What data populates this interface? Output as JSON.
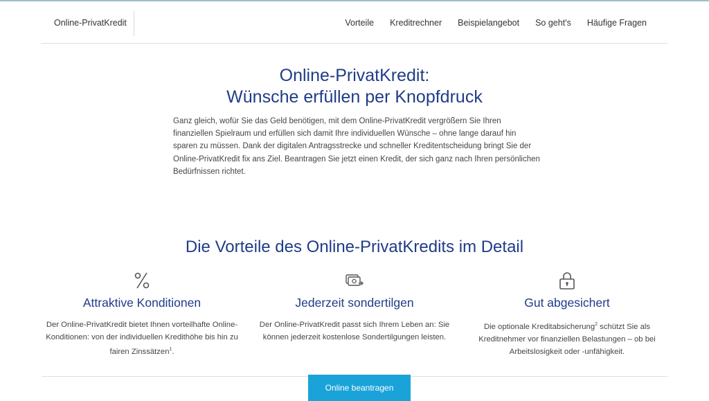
{
  "header": {
    "logo": "Online-PrivatKredit",
    "nav": [
      "Vorteile",
      "Kreditrechner",
      "Beispielangebot",
      "So geht's",
      "Häufige Fragen"
    ]
  },
  "hero": {
    "title_line1": "Online-PrivatKredit:",
    "title_line2": "Wünsche erfüllen per Knopfdruck",
    "text": "Ganz gleich, wofür Sie das Geld benötigen, mit dem Online-PrivatKredit vergrößern Sie Ihren finanziellen Spielraum und erfüllen sich damit Ihre individuellen Wünsche – ohne lange darauf hin sparen zu müssen. Dank der digitalen Antragsstrecke und schneller Kreditentscheidung bringt Sie der Online-PrivatKredit fix ans Ziel. Beantragen Sie jetzt einen Kredit, der sich ganz nach Ihren persönlichen Bedürfnissen richtet."
  },
  "advantages": {
    "title": "Die Vorteile des Online-PrivatKredits im Detail",
    "items": [
      {
        "icon": "percent-icon",
        "title": "Attraktive Konditionen",
        "text": "Der Online-PrivatKredit bietet Ihnen vorteilhafte Online-Konditionen: von der individuellen Kredithöhe bis hin zu fairen Zinssätzen",
        "sup": "1",
        "text_after": "."
      },
      {
        "icon": "money-transfer-icon",
        "title": "Jederzeit sondertilgen",
        "text": "Der Online-PrivatKredit passt sich Ihrem Leben an: Sie können jederzeit kostenlose Sondertilgungen leisten."
      },
      {
        "icon": "lock-icon",
        "title": "Gut abgesichert",
        "text_before": "Die optionale Kreditabsicherung",
        "sup": "2",
        "text": " schützt Sie als Kreditnehmer vor finanziellen Belastungen – ob bei Arbeitslosigkeit oder -unfähigkeit."
      }
    ]
  },
  "cta": {
    "label": "Online beantragen"
  },
  "colors": {
    "accent": "#1f3c88",
    "button": "#1aa3d9"
  }
}
